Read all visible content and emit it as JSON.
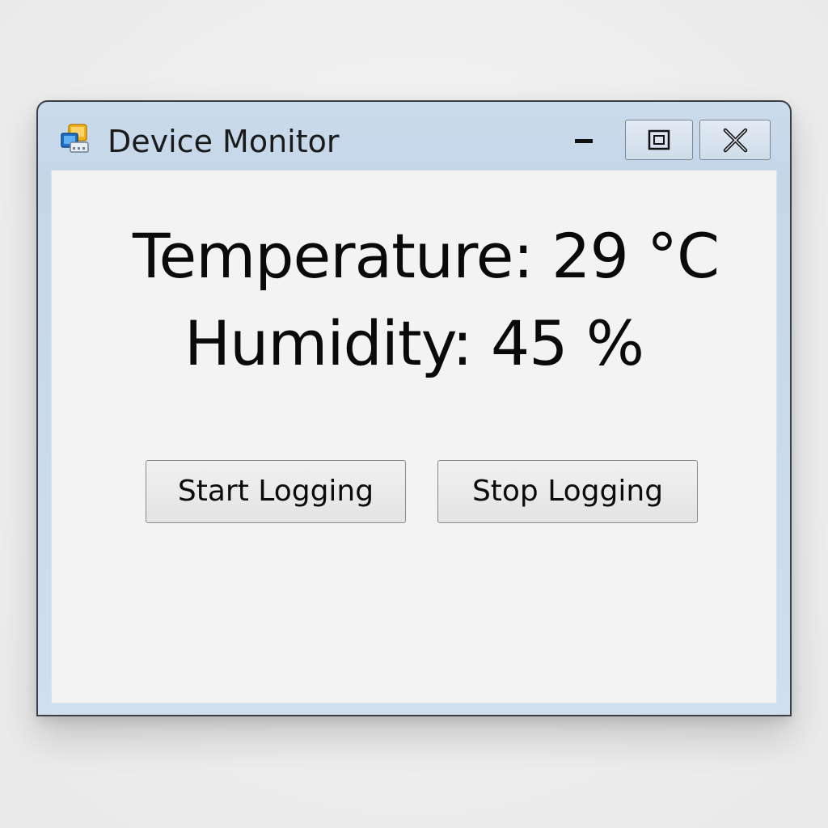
{
  "window": {
    "title": "Device Monitor",
    "icon": "monitor-app-icon",
    "controls": {
      "minimize_icon": "minimize-icon",
      "maximize_icon": "maximize-icon",
      "close_icon": "close-icon"
    }
  },
  "readings": {
    "temperature": "Temperature: 29 °C",
    "humidity": "Humidity: 45 %"
  },
  "buttons": {
    "start_label": "Start Logging",
    "stop_label": "Stop Logging"
  },
  "colors": {
    "titlebar": "#c4d6e9",
    "client_bg": "#f3f3f3",
    "border": "#3a3f45"
  }
}
